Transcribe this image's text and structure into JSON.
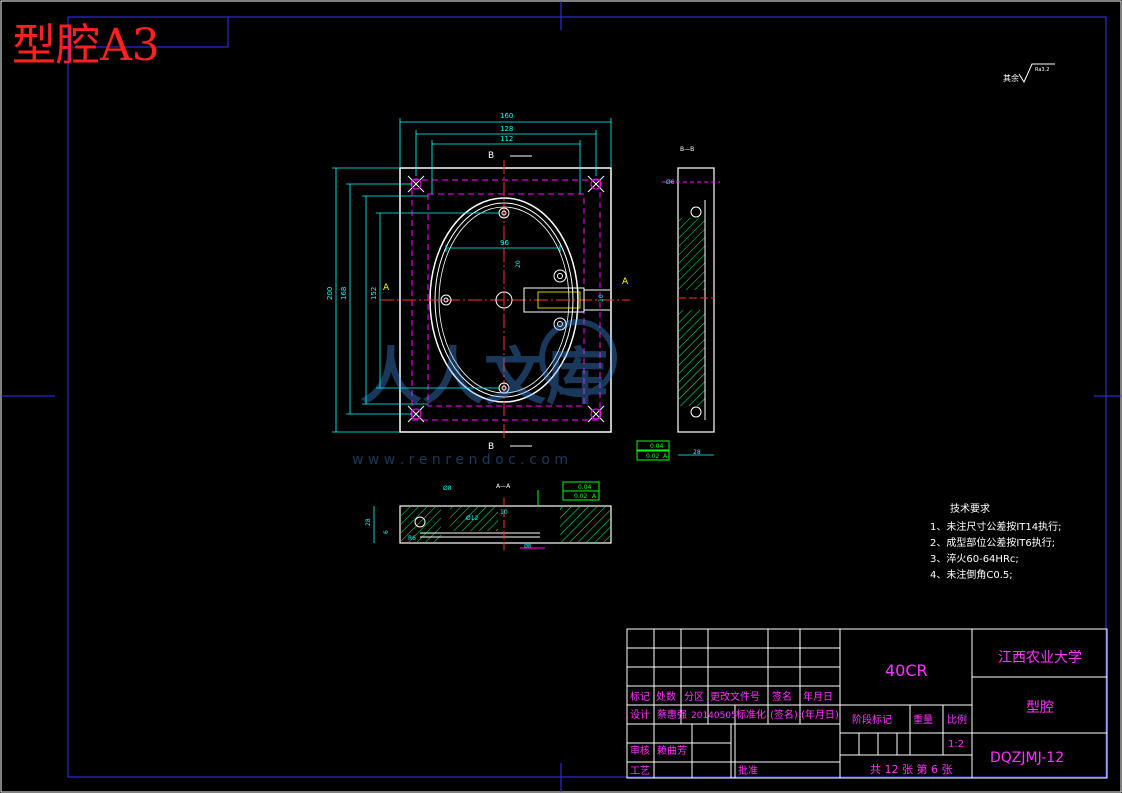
{
  "title_label": "型腔A3",
  "surface_note": {
    "prefix": "其余",
    "value": "Ra3.2"
  },
  "main_view": {
    "dim_160": "160",
    "dim_128": "128",
    "dim_112": "112",
    "dim_96": "96",
    "dim_200": "200",
    "dim_168": "168",
    "dim_152": "152",
    "dim_20": "20",
    "dim_10": "10",
    "section_b": "B",
    "section_a": "A"
  },
  "side_view": {
    "label": "B—B",
    "dim_6": "Ø6",
    "dim_28": "28",
    "tol_1_value": "0.04",
    "tol_2_value": "0.02",
    "tol_2_ref": "A"
  },
  "section_aa": {
    "label": "A—A",
    "dim_8": "Ø8",
    "dim_12": "Ø12",
    "dim_10": "10",
    "dim_28": "28",
    "dim_6": "6",
    "dim_r6": "R6",
    "dim_68": "Ø8",
    "tol_1_value": "0.04",
    "tol_2_value": "0.02",
    "tol_2_ref": "A"
  },
  "tech_requirements": {
    "heading": "技术要求",
    "items": [
      "1、未注尺寸公差按IT14执行;",
      "2、成型部位公差按IT6执行;",
      "3、淬火60-64HRc;",
      "4、未注倒角C0.5;"
    ]
  },
  "watermark": {
    "text": "人人文库",
    "url": "w w w . r e n r e n d o c . c o m"
  },
  "title_block": {
    "material": "40CR",
    "school": "江西农业大学",
    "part_name": "型腔",
    "drawing_number": "DQZJMJ-12",
    "row_headers": [
      "标记",
      "处数",
      "分区",
      "更改文件号",
      "签名",
      "年月日"
    ],
    "design_label": "设计",
    "designer": "蔡惠强",
    "design_date": "20140505",
    "standardize_label": "标准化",
    "signature_label": "(签名)",
    "date_label": "(年月日)",
    "stage_mark_label": "阶段标记",
    "weight_label": "重量",
    "scale_label": "比例",
    "scale_value": "1:2",
    "review_label": "审核",
    "reviewer": "赖曲芳",
    "process_label": "工艺",
    "approve_label": "批准",
    "sheet_info": "共 12 张 第 6 张"
  }
}
